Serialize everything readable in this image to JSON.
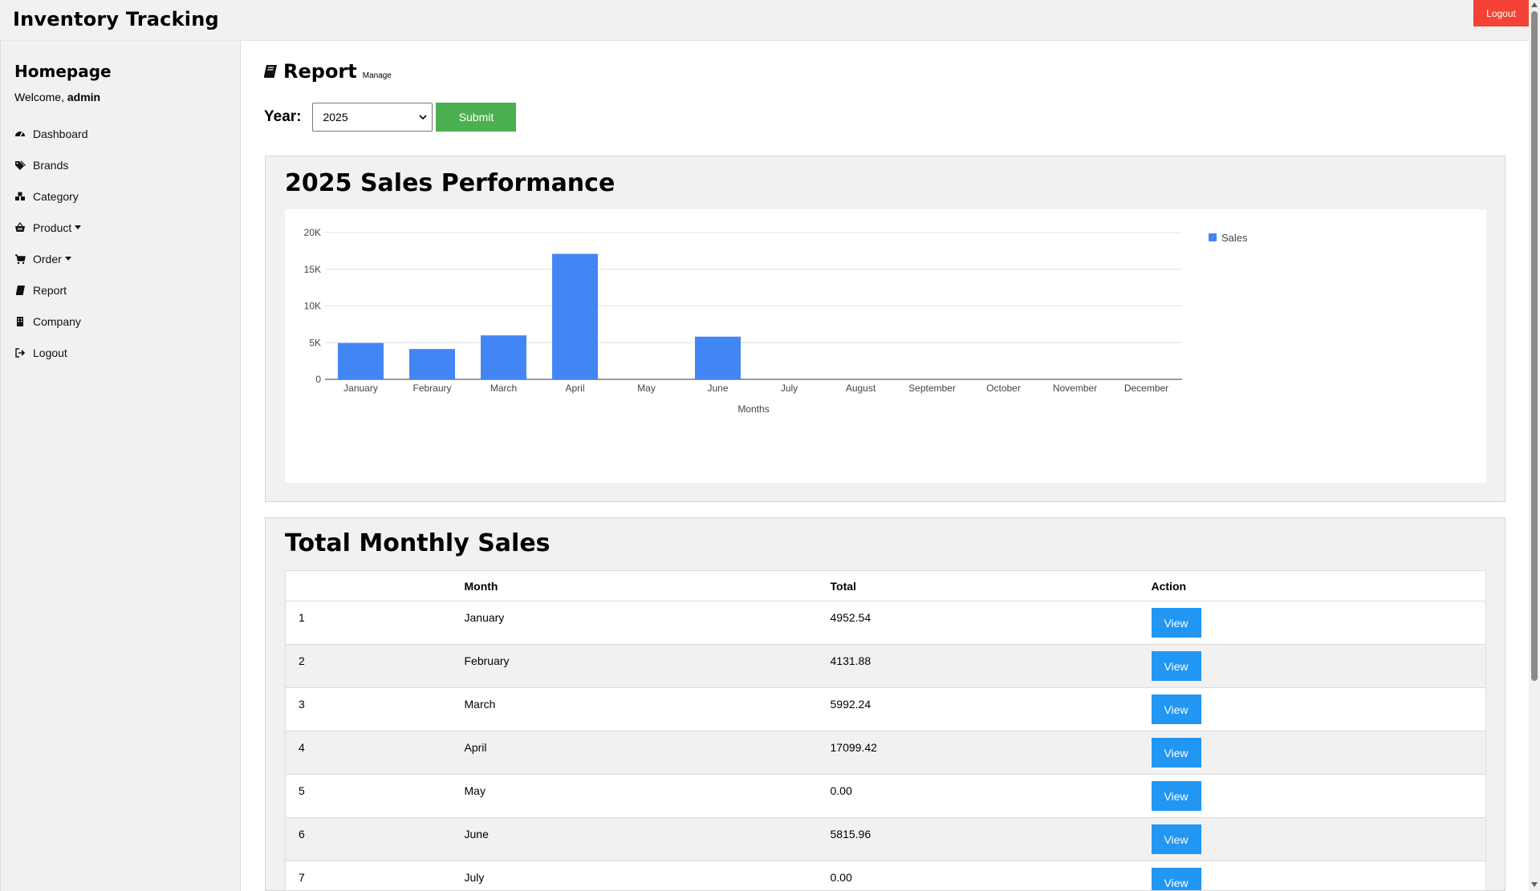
{
  "app": {
    "title": "Inventory Tracking",
    "logout_label": "Logout"
  },
  "sidebar": {
    "title": "Homepage",
    "welcome_prefix": "Welcome, ",
    "username": "admin",
    "items": [
      {
        "label": "Dashboard",
        "icon": "dashboard-icon",
        "dropdown": false
      },
      {
        "label": "Brands",
        "icon": "tags-icon",
        "dropdown": false
      },
      {
        "label": "Category",
        "icon": "cubes-icon",
        "dropdown": false
      },
      {
        "label": "Product",
        "icon": "basket-icon",
        "dropdown": true
      },
      {
        "label": "Order",
        "icon": "cart-icon",
        "dropdown": true
      },
      {
        "label": "Report",
        "icon": "book-icon",
        "dropdown": false
      },
      {
        "label": "Company",
        "icon": "building-icon",
        "dropdown": false
      },
      {
        "label": "Logout",
        "icon": "sign-out-icon",
        "dropdown": false
      }
    ]
  },
  "page": {
    "title": "Report",
    "subtitle": "Manage",
    "icon": "book-icon",
    "year_label": "Year:",
    "year_value": "2025",
    "submit_label": "Submit"
  },
  "chart_panel": {
    "title": "2025 Sales Performance"
  },
  "chart_data": {
    "type": "bar",
    "categories": [
      "January",
      "Febraury",
      "March",
      "April",
      "May",
      "June",
      "July",
      "August",
      "September",
      "October",
      "November",
      "December"
    ],
    "series": [
      {
        "name": "Sales",
        "values": [
          4952.54,
          4131.88,
          5992.24,
          17099.42,
          0,
          5815.96,
          0,
          0,
          0,
          0,
          0,
          0
        ],
        "color": "#4285f4"
      }
    ],
    "xlabel": "Months",
    "ylabel": "",
    "ylim": [
      0,
      20000
    ],
    "yticks": [
      "0",
      "5K",
      "10K",
      "15K",
      "20K"
    ],
    "ytick_values": [
      0,
      5000,
      10000,
      15000,
      20000
    ],
    "grid": true,
    "legend": "right"
  },
  "table_panel": {
    "title": "Total Monthly Sales",
    "headers": [
      "",
      "Month",
      "Total",
      "Action"
    ],
    "view_label": "View",
    "rows": [
      {
        "n": "1",
        "month": "January",
        "total": "4952.54"
      },
      {
        "n": "2",
        "month": "February",
        "total": "4131.88"
      },
      {
        "n": "3",
        "month": "March",
        "total": "5992.24"
      },
      {
        "n": "4",
        "month": "April",
        "total": "17099.42"
      },
      {
        "n": "5",
        "month": "May",
        "total": "0.00"
      },
      {
        "n": "6",
        "month": "June",
        "total": "5815.96"
      },
      {
        "n": "7",
        "month": "July",
        "total": "0.00"
      }
    ]
  }
}
